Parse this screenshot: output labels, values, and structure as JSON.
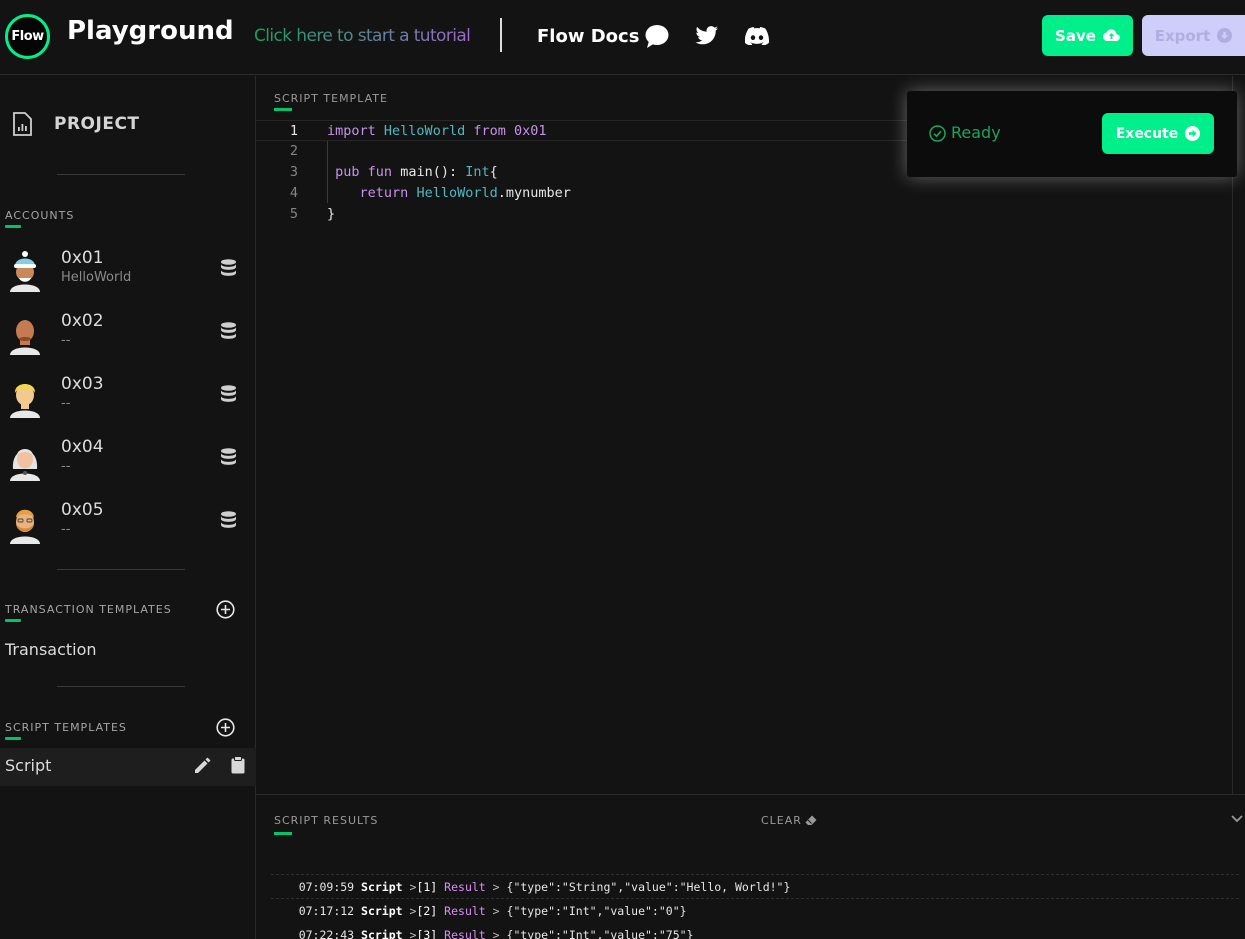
{
  "header": {
    "logo_text": "Flow",
    "title": "Playground",
    "tutorial_link": "Click here to start a tutorial",
    "docs_link": "Flow Docs",
    "save_label": "Save",
    "export_label": "Export",
    "social_icons": [
      "chat-bubble-icon",
      "twitter-icon",
      "discord-icon"
    ]
  },
  "sidebar": {
    "project_label": "PROJECT",
    "accounts_label": "ACCOUNTS",
    "accounts": [
      {
        "address": "0x01",
        "name": "HelloWorld"
      },
      {
        "address": "0x02",
        "name": "--"
      },
      {
        "address": "0x03",
        "name": "--"
      },
      {
        "address": "0x04",
        "name": "--"
      },
      {
        "address": "0x05",
        "name": "--"
      }
    ],
    "transaction_templates_label": "TRANSACTION TEMPLATES",
    "transaction_templates": [
      "Transaction"
    ],
    "script_templates_label": "SCRIPT TEMPLATES",
    "script_templates": [
      "Script"
    ]
  },
  "editor": {
    "label": "SCRIPT TEMPLATE",
    "line_numbers": [
      "1",
      "2",
      "3",
      "4",
      "5"
    ],
    "active_line": 1
  },
  "status": {
    "text": "Ready",
    "execute_label": "Execute"
  },
  "results": {
    "label": "SCRIPT RESULTS",
    "clear_label": "CLEAR",
    "rows": [
      {
        "time": "07:09:59",
        "type": "Script",
        "index": "[1]",
        "result": "Result",
        "value": "{\"type\":\"String\",\"value\":\"Hello, World!\"}"
      },
      {
        "time": "07:17:12",
        "type": "Script",
        "index": "[2]",
        "result": "Result",
        "value": "{\"type\":\"Int\",\"value\":\"0\"}"
      },
      {
        "time": "07:22:43",
        "type": "Script",
        "index": "[3]",
        "result": "Result",
        "value": "{\"type\":\"Int\",\"value\":\"75\"}"
      }
    ]
  },
  "colors": {
    "accent": "#00ef8b",
    "background": "#131313",
    "export_button": "#cfcdf9",
    "keyword": "#c792ea",
    "type": "#4fb7c0"
  }
}
